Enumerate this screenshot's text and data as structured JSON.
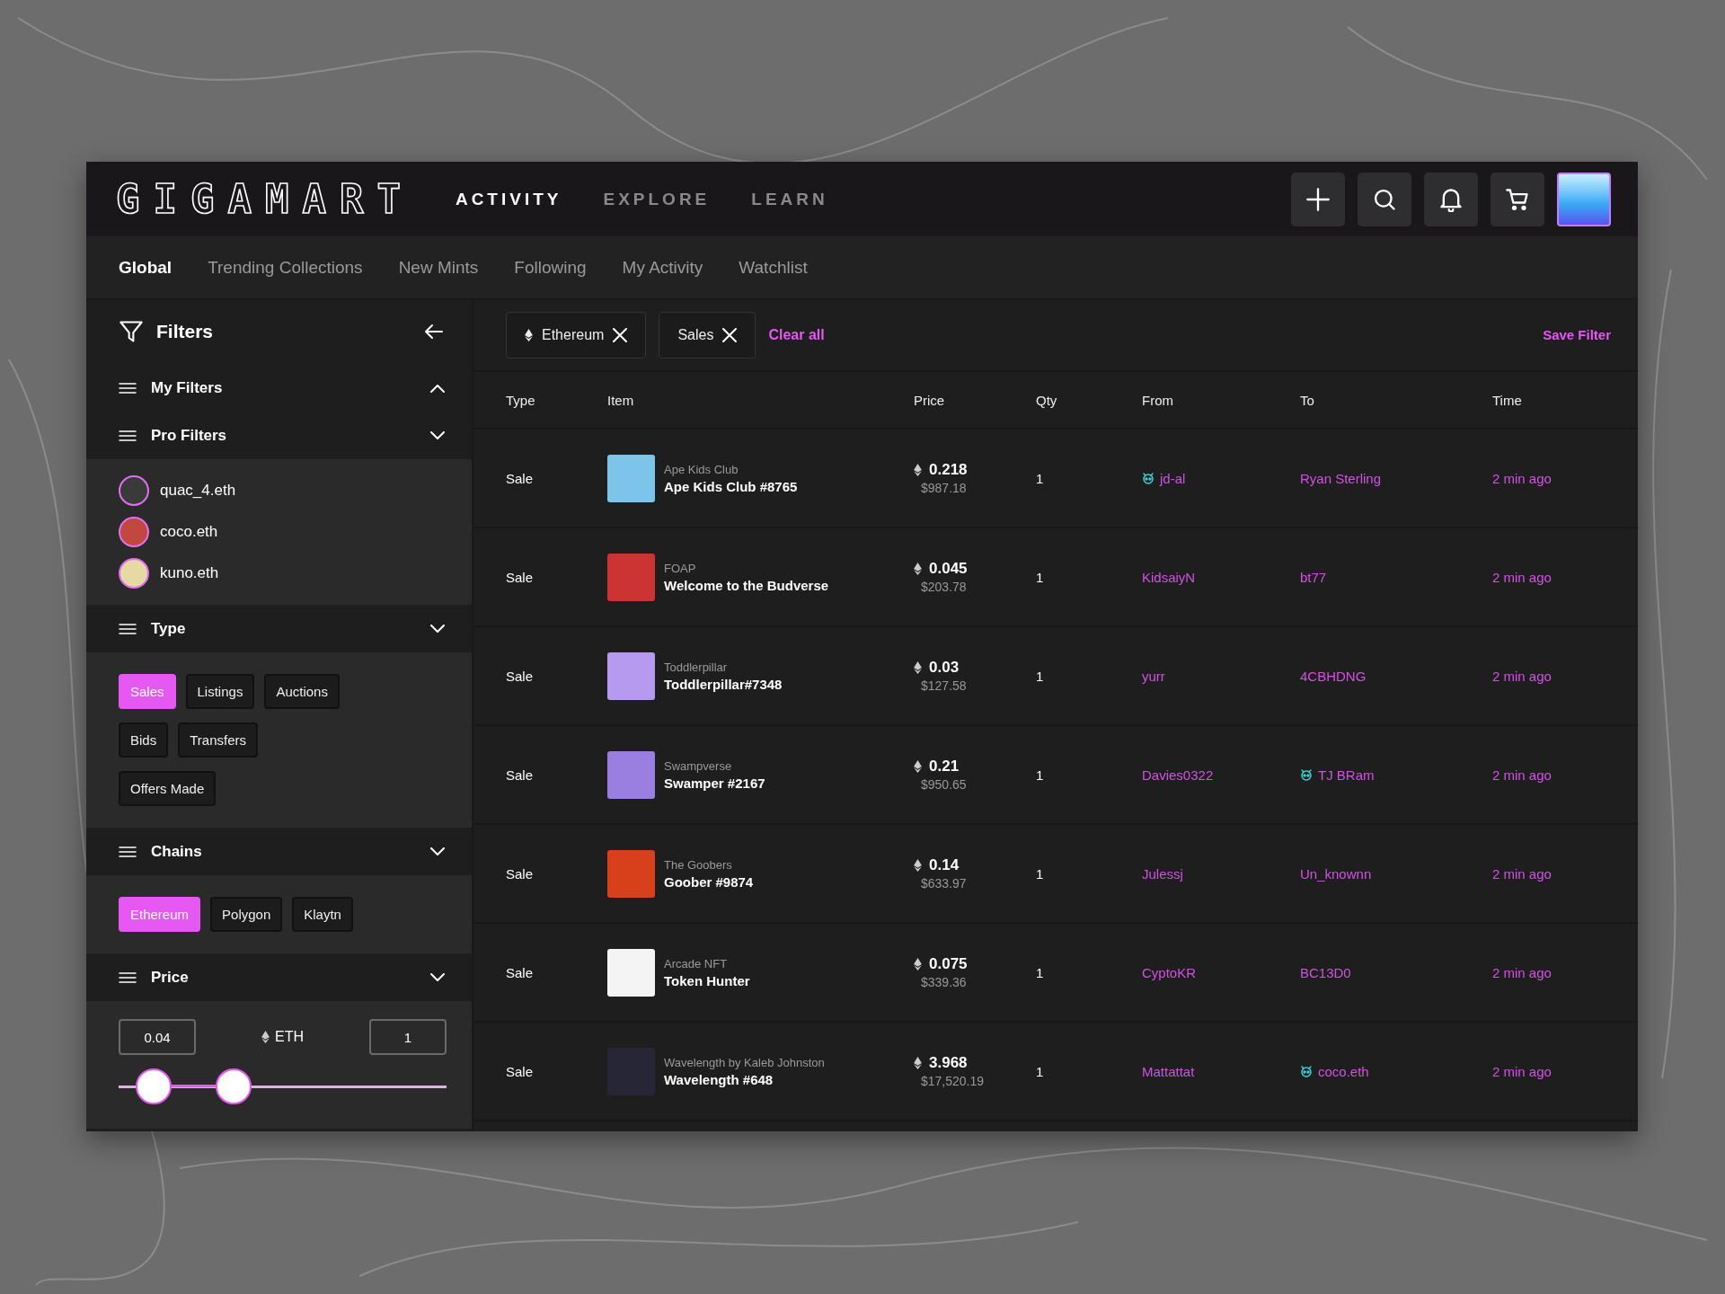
{
  "brand": {
    "logo": "GIGAMART"
  },
  "main_nav": [
    {
      "label": "ACTIVITY",
      "selected": true
    },
    {
      "label": "EXPLORE",
      "selected": false
    },
    {
      "label": "LEARN",
      "selected": false
    }
  ],
  "sub_nav": [
    {
      "label": "Global",
      "selected": true
    },
    {
      "label": "Trending Collections",
      "selected": false
    },
    {
      "label": "New Mints",
      "selected": false
    },
    {
      "label": "Following",
      "selected": false
    },
    {
      "label": "My Activity",
      "selected": false
    },
    {
      "label": "Watchlist",
      "selected": false
    }
  ],
  "filters": {
    "title": "Filters",
    "sections": [
      {
        "title": "My Filters",
        "expanded": true,
        "kind": "plain"
      },
      {
        "title": "Pro Filters",
        "expanded": false,
        "kind": "users",
        "users": [
          "quac_4.eth",
          "coco.eth",
          "kuno.eth"
        ]
      },
      {
        "title": "Type",
        "expanded": false,
        "kind": "chips",
        "chips": [
          {
            "label": "Sales",
            "selected": true
          },
          {
            "label": "Listings",
            "selected": false
          },
          {
            "label": "Auctions",
            "selected": false
          },
          {
            "label": "Bids",
            "selected": false
          },
          {
            "label": "Transfers",
            "selected": false
          },
          {
            "label": "Offers Made",
            "selected": false
          }
        ]
      },
      {
        "title": "Chains",
        "expanded": false,
        "kind": "chips",
        "chips": [
          {
            "label": "Ethereum",
            "selected": true
          },
          {
            "label": "Polygon",
            "selected": false
          },
          {
            "label": "Klaytn",
            "selected": false
          }
        ]
      },
      {
        "title": "Price",
        "expanded": false,
        "kind": "range",
        "min": "0.04",
        "unit": "ETH",
        "max": "1",
        "low_thumb": {
          "level": 0.106
        },
        "high_thumb": {
          "level": 0.35
        }
      }
    ]
  },
  "active_filters": {
    "chips": [
      {
        "label": "Ethereum",
        "kind": "chain"
      },
      {
        "label": "Sales",
        "kind": "type"
      }
    ],
    "clear": "Clear all",
    "save": "Save Filter"
  },
  "table": {
    "columns": [
      "Type",
      "Item",
      "Price",
      "Qty",
      "From",
      "To",
      "Time"
    ],
    "rows": [
      {
        "type": "Sale",
        "collection": "Ape Kids Club",
        "item": "Ape Kids Club #8765",
        "price": "0.218",
        "usd": "$987.18",
        "qty": "1",
        "from": {
          "name": "jd-al",
          "verified": true
        },
        "to": {
          "name": "Ryan Sterling",
          "verified": false
        },
        "time": "2 min ago"
      },
      {
        "type": "Sale",
        "collection": "FOAP",
        "item": "Welcome to the Budverse",
        "price": "0.045",
        "usd": "$203.78",
        "qty": "1",
        "from": {
          "name": "KidsaiyN",
          "verified": false
        },
        "to": {
          "name": "bt77",
          "verified": false
        },
        "time": "2 min ago"
      },
      {
        "type": "Sale",
        "collection": "Toddlerpillar",
        "item": "Toddlerpillar#7348",
        "price": "0.03",
        "usd": "$127.58",
        "qty": "1",
        "from": {
          "name": "yurr",
          "verified": false
        },
        "to": {
          "name": "4CBHDNG",
          "verified": false
        },
        "time": "2 min ago"
      },
      {
        "type": "Sale",
        "collection": "Swampverse",
        "item": "Swamper #2167",
        "price": "0.21",
        "usd": "$950.65",
        "qty": "1",
        "from": {
          "name": "Davies0322",
          "verified": false
        },
        "to": {
          "name": "TJ BRam",
          "verified": true
        },
        "time": "2 min ago"
      },
      {
        "type": "Sale",
        "collection": "The Goobers",
        "item": "Goober #9874",
        "price": "0.14",
        "usd": "$633.97",
        "qty": "1",
        "from": {
          "name": "Julessj",
          "verified": false
        },
        "to": {
          "name": "Un_knownn",
          "verified": false
        },
        "time": "2 min ago"
      },
      {
        "type": "Sale",
        "collection": "Arcade NFT",
        "item": "Token Hunter",
        "price": "0.075",
        "usd": "$339.36",
        "qty": "1",
        "from": {
          "name": "CyptoKR",
          "verified": false
        },
        "to": {
          "name": "BC13D0",
          "verified": false
        },
        "time": "2 min ago"
      },
      {
        "type": "Sale",
        "collection": "Wavelength by Kaleb Johnston",
        "item": "Wavelength #648",
        "price": "3.968",
        "usd": "$17,520.19",
        "qty": "1",
        "from": {
          "name": "Mattattat",
          "verified": false
        },
        "to": {
          "name": "coco.eth",
          "verified": true
        },
        "time": "2 min ago"
      }
    ]
  }
}
